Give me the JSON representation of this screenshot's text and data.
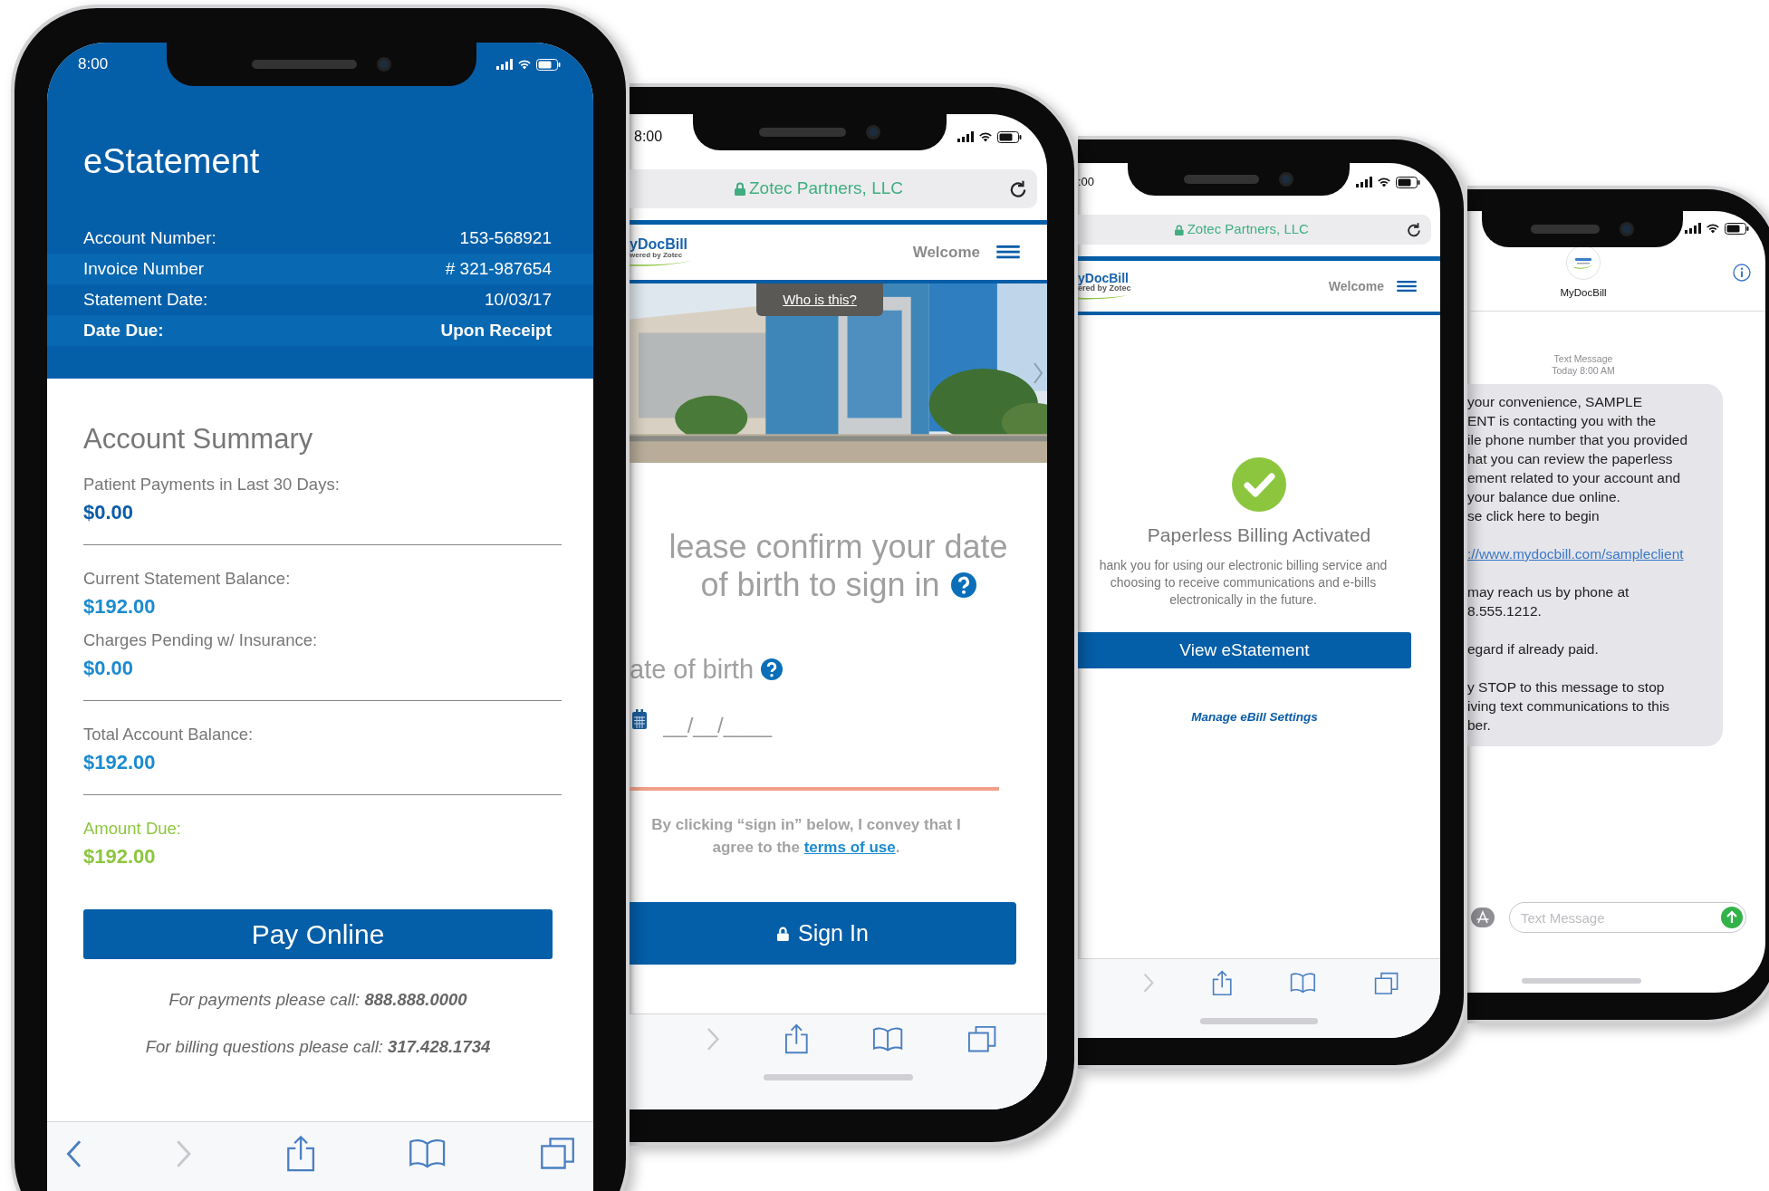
{
  "phones": [
    {
      "kind": "statement",
      "status": {
        "time": "8:00"
      },
      "title": "eStatement",
      "details": [
        {
          "label": "Account Number:",
          "value": "153-568921",
          "strong": false
        },
        {
          "label": "Invoice Number",
          "value": "# 321-987654",
          "strong": false
        },
        {
          "label": "Statement Date:",
          "value": "10/03/17",
          "strong": false
        },
        {
          "label": "Date Due:",
          "value": "Upon Receipt",
          "strong": true
        }
      ],
      "summary": {
        "heading": "Account Summary",
        "groups": [
          {
            "items": [
              {
                "label": "Patient Payments in Last 30 Days:",
                "value": "$0.00",
                "color": "#0a5ca8",
                "highlight": false
              }
            ]
          },
          {
            "items": [
              {
                "label": "Current Statement Balance:",
                "value": "$192.00",
                "color": "#1b8bd0",
                "highlight": false
              },
              {
                "label": "Charges Pending w/ Insurance:",
                "value": "$0.00",
                "color": "#1b8bd0",
                "highlight": false
              }
            ]
          },
          {
            "items": [
              {
                "label": "Total Account Balance:",
                "value": "$192.00",
                "color": "#1b8bd0",
                "highlight": false
              }
            ]
          },
          {
            "items": [
              {
                "label": "Amount Due:",
                "value": "$192.00",
                "color": "#8cc63f",
                "highlight": true
              }
            ]
          }
        ]
      },
      "button": "Pay Online",
      "contacts": [
        "For payments please call: **888.888.0000**",
        "For billing questions please call: **317.428.1734**"
      ],
      "toolbar": [
        {
          "kind": "back",
          "disabled": false
        },
        {
          "kind": "forward",
          "disabled": true
        },
        {
          "kind": "share",
          "disabled": false
        },
        {
          "kind": "bookmarks",
          "disabled": false
        },
        {
          "kind": "tabs",
          "disabled": false
        }
      ]
    },
    {
      "kind": "signin",
      "status": {
        "time": "8:00"
      },
      "address": "Zotec Partners, LLC",
      "logo": {
        "name": "yDocBill",
        "tagline": "wered by Zotec"
      },
      "nav_label": "Welcome",
      "photo": {
        "kind": "picture",
        "tab": "Who is this?"
      },
      "heading": [
        "lease confirm your date",
        "of birth to sign in"
      ],
      "dob_label": "ate of birth",
      "dob_field": {
        "placeholder": "__/__/____"
      },
      "consent": {
        "text": "By clicking “sign in” below, I convey that I agree to the ",
        "link": "terms of use",
        "end": "."
      },
      "button": "Sign In",
      "toolbar": [
        {
          "kind": "forward",
          "disabled": true
        },
        {
          "kind": "share",
          "disabled": false
        },
        {
          "kind": "bookmarks",
          "disabled": false
        },
        {
          "kind": "tabs",
          "disabled": false
        }
      ]
    },
    {
      "kind": "confirm",
      "status": {
        "time": ":00"
      },
      "address": "Zotec Partners, LLC",
      "logo": {
        "name": "yDocBill",
        "tagline": "ered by Zotec"
      },
      "nav_label": "Welcome",
      "title": "Paperless Billing Activated",
      "message": "hank you for using our electronic billing service and choosing to receive communications and e-bills electronically in the future.",
      "button": "View eStatement",
      "link": "Manage eBill Settings",
      "toolbar": [
        {
          "kind": "forward",
          "disabled": true
        },
        {
          "kind": "share",
          "disabled": false
        },
        {
          "kind": "bookmarks",
          "disabled": false
        },
        {
          "kind": "tabs",
          "disabled": false
        }
      ]
    },
    {
      "kind": "messages",
      "contact": "MyDocBill",
      "meta": [
        "Text Message",
        "Today 8:00 AM"
      ],
      "bubble": [
        {
          "kind": "text",
          "lines": [
            "your convenience, SAMPLE",
            "ENT is contacting you with the",
            "ile phone number that you provided",
            "hat you can review the paperless",
            "ement related to your account and",
            "your balance due online.",
            "se click here to begin"
          ]
        },
        {
          "kind": "link",
          "lines": [
            "://www.mydocbill.com/sampleclient"
          ]
        },
        {
          "kind": "text",
          "lines": [
            "may reach us by phone at",
            "8.555.1212."
          ]
        },
        {
          "kind": "text",
          "lines": [
            "egard if already paid."
          ]
        },
        {
          "kind": "text",
          "lines": [
            "y STOP to this message to stop",
            "iving text communications to this",
            "ber."
          ]
        }
      ],
      "composer": {
        "placeholder": "Text Message"
      }
    }
  ]
}
